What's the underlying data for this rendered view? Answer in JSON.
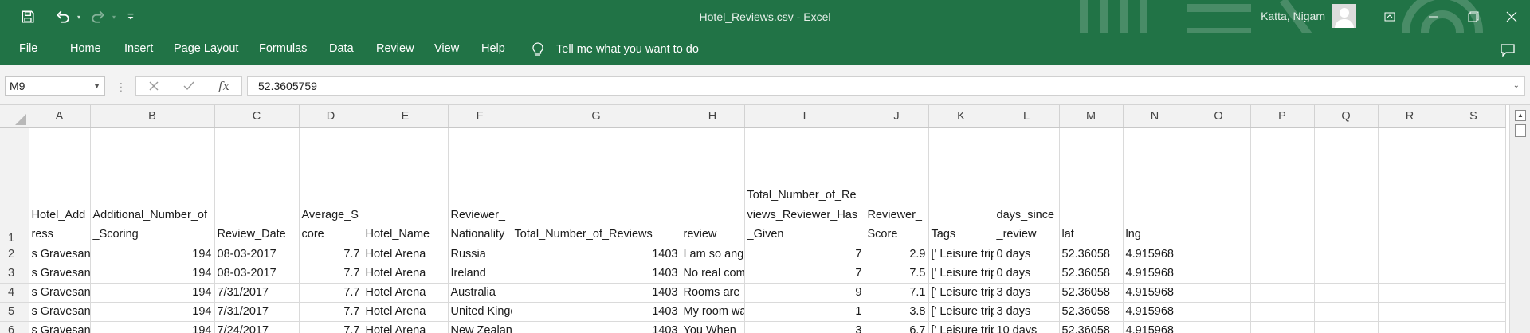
{
  "window": {
    "doc_title": "Hotel_Reviews.csv  -  Excel",
    "user_name": "Katta, Nigam"
  },
  "colors": {
    "brand": "#217346",
    "grid_line": "#dadada",
    "header_bg": "#f2f2f2"
  },
  "ribbon": {
    "tabs": [
      "File",
      "Home",
      "Insert",
      "Page Layout",
      "Formulas",
      "Data",
      "Review",
      "View",
      "Help"
    ],
    "tell_me": "Tell me what you want to do"
  },
  "formula_bar": {
    "name_box": "M9",
    "content": "52.3605759",
    "fx_label": "fx"
  },
  "sheet": {
    "columns": [
      "A",
      "B",
      "C",
      "D",
      "E",
      "F",
      "G",
      "H",
      "I",
      "J",
      "K",
      "L",
      "M",
      "N",
      "O",
      "P",
      "Q",
      "R",
      "S"
    ],
    "row_numbers": [
      "1",
      "2",
      "3",
      "4",
      "5",
      "6"
    ],
    "header_row": [
      "Hotel_Address",
      "Additional_Number_of_Scoring",
      "Review_Date",
      "Average_Score",
      "Hotel_Name",
      "Reviewer_Nationality",
      "Total_Number_of_Reviews",
      "review",
      "Total_Number_of_Reviews_Reviewer_Has_Given",
      "Reviewer_Score",
      "Tags",
      "days_since_review",
      "lat",
      "lng",
      "",
      "",
      "",
      "",
      ""
    ],
    "rows": [
      [
        " s Gravesande",
        "194",
        "08-03-2017",
        "7.7",
        "Hotel Arena",
        "Russia",
        "1403",
        "I am so angry",
        "7",
        "2.9",
        "[' Leisure trip",
        "0 days",
        "52.36058",
        "4.915968",
        "",
        "",
        "",
        "",
        ""
      ],
      [
        " s Gravesande",
        "194",
        "08-03-2017",
        "7.7",
        "Hotel Arena",
        "Ireland",
        "1403",
        "No real complaints",
        "7",
        "7.5",
        "[' Leisure trip",
        "0 days",
        "52.36058",
        "4.915968",
        "",
        "",
        "",
        "",
        ""
      ],
      [
        " s Gravesande",
        "194",
        "7/31/2017",
        "7.7",
        "Hotel Arena",
        "Australia",
        "1403",
        "Rooms are",
        "9",
        "7.1",
        "[' Leisure trip",
        "3 days",
        "52.36058",
        "4.915968",
        "",
        "",
        "",
        "",
        ""
      ],
      [
        " s Gravesande",
        "194",
        "7/31/2017",
        "7.7",
        "Hotel Arena",
        "United Kingdom",
        "1403",
        "My room was",
        "1",
        "3.8",
        "[' Leisure trip",
        "3 days",
        "52.36058",
        "4.915968",
        "",
        "",
        "",
        "",
        ""
      ],
      [
        " s Gravesande",
        "194",
        "7/24/2017",
        "7.7",
        "Hotel Arena",
        "New Zealand",
        "1403",
        "You When",
        "3",
        "6.7",
        "[' Leisure trip",
        "10 days",
        "52.36058",
        "4.915968",
        "",
        "",
        "",
        "",
        ""
      ]
    ]
  }
}
